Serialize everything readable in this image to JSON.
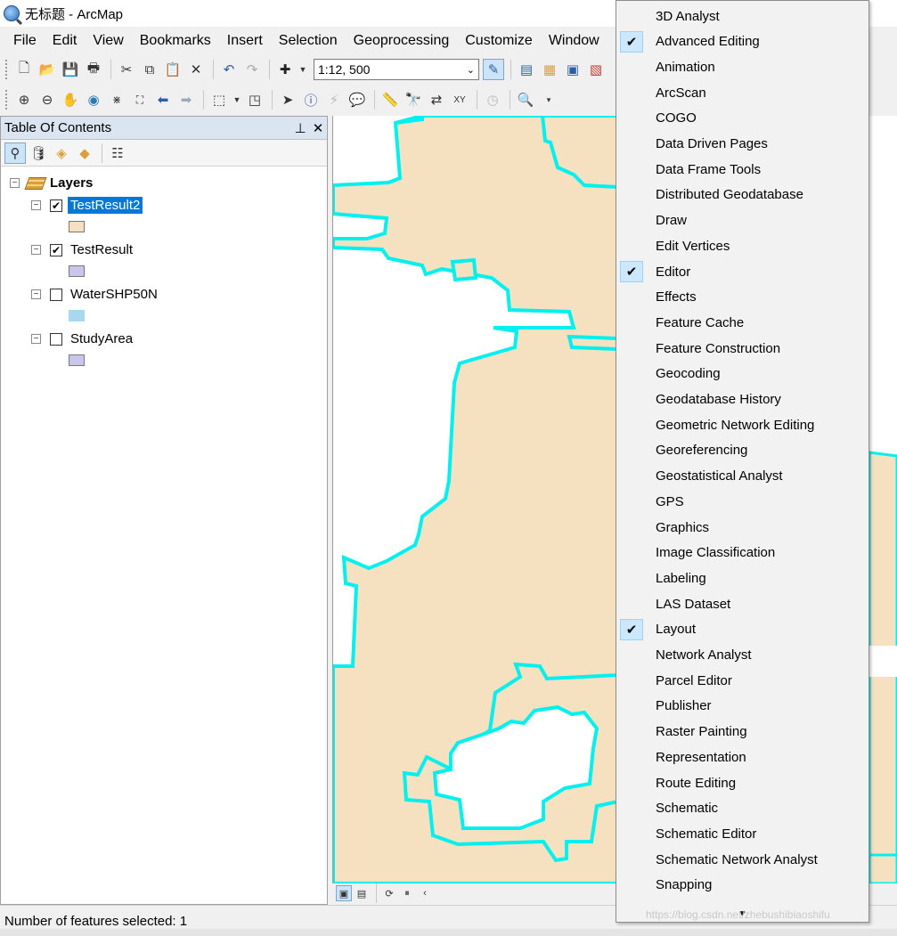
{
  "window": {
    "title": "无标题 - ArcMap"
  },
  "menubar": {
    "items": [
      "File",
      "Edit",
      "View",
      "Bookmarks",
      "Insert",
      "Selection",
      "Geoprocessing",
      "Customize",
      "Window"
    ]
  },
  "toolbar": {
    "scale": "1:12, 500"
  },
  "toc": {
    "title": "Table Of Contents",
    "pin_glyph": "ꟷ",
    "close_glyph": "✕",
    "root_label": "Layers",
    "layers": [
      {
        "name": "TestResult2",
        "checked": true,
        "selected": true,
        "swatch": "#f5e1c0"
      },
      {
        "name": "TestResult",
        "checked": true,
        "selected": false,
        "swatch": "#c9c6ec"
      },
      {
        "name": "WaterSHP50N",
        "checked": false,
        "selected": false,
        "swatch": "#a8d8f0"
      },
      {
        "name": "StudyArea",
        "checked": false,
        "selected": false,
        "swatch": "#c9c6ec"
      }
    ]
  },
  "map": {
    "fill_color": "#f5e1c0",
    "outline_color": "#00f0f0"
  },
  "status": {
    "text": "Number of features selected: 1"
  },
  "toolbars_menu": {
    "items": [
      {
        "label": "3D Analyst",
        "checked": false
      },
      {
        "label": "Advanced Editing",
        "checked": true
      },
      {
        "label": "Animation",
        "checked": false
      },
      {
        "label": "ArcScan",
        "checked": false
      },
      {
        "label": "COGO",
        "checked": false
      },
      {
        "label": "Data Driven Pages",
        "checked": false
      },
      {
        "label": "Data Frame Tools",
        "checked": false
      },
      {
        "label": "Distributed Geodatabase",
        "checked": false
      },
      {
        "label": "Draw",
        "checked": false
      },
      {
        "label": "Edit Vertices",
        "checked": false
      },
      {
        "label": "Editor",
        "checked": true
      },
      {
        "label": "Effects",
        "checked": false
      },
      {
        "label": "Feature Cache",
        "checked": false
      },
      {
        "label": "Feature Construction",
        "checked": false
      },
      {
        "label": "Geocoding",
        "checked": false
      },
      {
        "label": "Geodatabase History",
        "checked": false
      },
      {
        "label": "Geometric Network Editing",
        "checked": false
      },
      {
        "label": "Georeferencing",
        "checked": false
      },
      {
        "label": "Geostatistical Analyst",
        "checked": false
      },
      {
        "label": "GPS",
        "checked": false
      },
      {
        "label": "Graphics",
        "checked": false
      },
      {
        "label": "Image Classification",
        "checked": false
      },
      {
        "label": "Labeling",
        "checked": false
      },
      {
        "label": "LAS Dataset",
        "checked": false
      },
      {
        "label": "Layout",
        "checked": true
      },
      {
        "label": "Network Analyst",
        "checked": false
      },
      {
        "label": "Parcel Editor",
        "checked": false
      },
      {
        "label": "Publisher",
        "checked": false
      },
      {
        "label": "Raster Painting",
        "checked": false
      },
      {
        "label": "Representation",
        "checked": false
      },
      {
        "label": "Route Editing",
        "checked": false
      },
      {
        "label": "Schematic",
        "checked": false
      },
      {
        "label": "Schematic Editor",
        "checked": false
      },
      {
        "label": "Schematic Network Analyst",
        "checked": false
      },
      {
        "label": "Snapping",
        "checked": false
      }
    ],
    "more_glyph": "▼"
  },
  "watermark": "https://blog.csdn.net/zhebushibiaoshifu"
}
